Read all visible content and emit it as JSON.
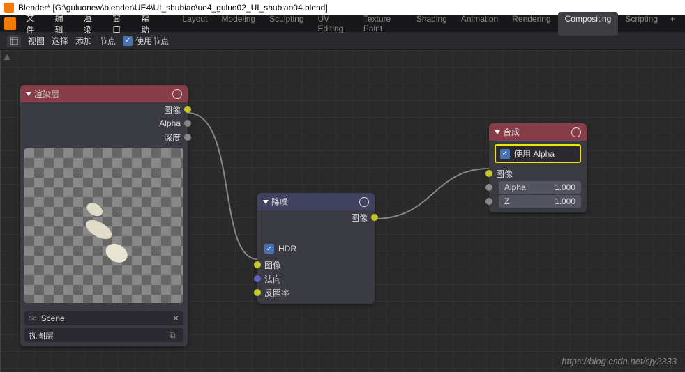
{
  "title": "Blender* [G:\\guluonew\\blender\\UE4\\UI_shubiao\\ue4_guluo02_UI_shubiao04.blend]",
  "menu": {
    "file": "文件",
    "edit": "编辑",
    "render": "渲染",
    "window": "窗口",
    "help": "帮助"
  },
  "workspaces": {
    "layout": "Layout",
    "modeling": "Modeling",
    "sculpting": "Sculpting",
    "uv": "UV Editing",
    "texpaint": "Texture Paint",
    "shading": "Shading",
    "anim": "Animation",
    "rendering": "Rendering",
    "compositing": "Compositing",
    "scripting": "Scripting",
    "plus": "+"
  },
  "toolbar": {
    "view": "视图",
    "select": "选择",
    "add": "添加",
    "node": "节点",
    "usenodes": "使用节点"
  },
  "node1": {
    "title": "渲染层",
    "out_image": "图像",
    "out_alpha": "Alpha",
    "out_depth": "深度",
    "scene": "Scene",
    "layer": "视图层",
    "scene_icon": "Sc"
  },
  "node2": {
    "title": "降噪",
    "out_image": "图像",
    "hdr": "HDR",
    "in_image": "图像",
    "in_normal": "法向",
    "in_albedo": "反照率"
  },
  "node3": {
    "title": "合成",
    "usealpha": "使用 Alpha",
    "in_image": "图像",
    "alpha_label": "Alpha",
    "alpha_val": "1.000",
    "z_label": "Z",
    "z_val": "1.000"
  },
  "watermark": "https://blog.csdn.net/sjy2333"
}
